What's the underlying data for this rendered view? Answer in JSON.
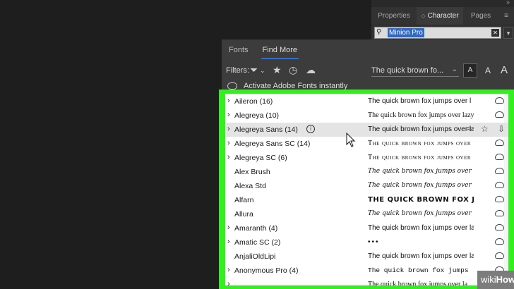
{
  "character_panel": {
    "tabs": [
      "Properties",
      "Character",
      "Pages"
    ],
    "active_tab": "Character",
    "font_search_value": "Minion Pro",
    "menu_glyph": "≡"
  },
  "fonts_panel": {
    "tabs": [
      "Fonts",
      "Find More"
    ],
    "active_tab": "Find More",
    "filters_label": "Filters:",
    "preview_text": "The quick brown fo...",
    "size_buttons": [
      "A",
      "A",
      "A"
    ],
    "activate_text": "Activate Adobe Fonts instantly"
  },
  "font_list": [
    {
      "name": "Aileron (16)",
      "expandable": true,
      "preview": "The quick brown fox jumps over l",
      "style": "sans"
    },
    {
      "name": "Alegreya (10)",
      "expandable": true,
      "preview": "The quick brown fox jumps over lazy",
      "style": "serif"
    },
    {
      "name": "Alegreya Sans (14)",
      "expandable": true,
      "preview": "The quick brown fox jumps over la",
      "style": "sans",
      "hover": true
    },
    {
      "name": "Alegreya Sans SC (14)",
      "expandable": true,
      "preview": "The quick brown fox jumps over",
      "style": "sc"
    },
    {
      "name": "Alegreya SC (6)",
      "expandable": true,
      "preview": "The quick brown fox jumps over",
      "style": "sc"
    },
    {
      "name": "Alex Brush",
      "expandable": false,
      "preview": "The quick brown fox jumps over lazy dog.",
      "style": "script"
    },
    {
      "name": "Alexa Std",
      "expandable": false,
      "preview": "The quick brown fox jumps over lazy dog.",
      "style": "script"
    },
    {
      "name": "Alfarn",
      "expandable": false,
      "preview": "THE QUICK BROWN FOX JUMF",
      "style": "black"
    },
    {
      "name": "Allura",
      "expandable": false,
      "preview": "The quick brown fox jumps over lazy dog.",
      "style": "script"
    },
    {
      "name": "Amaranth (4)",
      "expandable": true,
      "preview": "The quick brown fox jumps over la",
      "style": "sans"
    },
    {
      "name": "Amatic SC (2)",
      "expandable": true,
      "preview": "•••",
      "style": "dots"
    },
    {
      "name": "AnjaliOldLipi",
      "expandable": false,
      "preview": "The quick brown fox jumps over la",
      "style": "sans"
    },
    {
      "name": "Anonymous Pro (4)",
      "expandable": true,
      "preview": "The quick brown fox jumps",
      "style": "mono"
    },
    {
      "name": "",
      "expandable": true,
      "preview": "The quick brown fox jumps over la",
      "style": "serif"
    }
  ],
  "watermark": {
    "wiki": "wiki",
    "how": "How"
  }
}
